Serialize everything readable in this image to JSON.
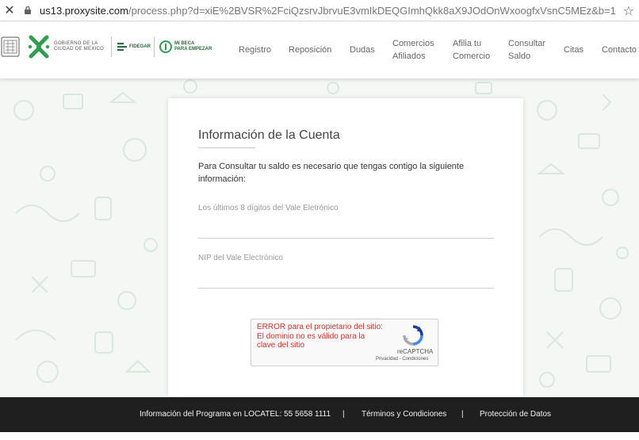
{
  "browser": {
    "url_host": "us13.proxysite.com",
    "url_path": "/process.php?d=xiE%2BVSR%2FciQzsrvJbrvuE3vmIkDEQGImhQkk8aX9JOdOnWxoogfxVsnC5MEz&b=1",
    "close_glyph": "✕",
    "star_glyph": "☆"
  },
  "header": {
    "gov_line1": "GOBIERNO DE LA",
    "gov_line2": "CIUDAD DE MÉXICO",
    "fidegar": "FIDEGAR",
    "beca_line1": "MI BECA",
    "beca_line2": "PARA EMPEZAR",
    "nav": [
      {
        "line1": "Registro",
        "line2": ""
      },
      {
        "line1": "Reposición",
        "line2": ""
      },
      {
        "line1": "Dudas",
        "line2": ""
      },
      {
        "line1": "Comercios",
        "line2": "Afiliados"
      },
      {
        "line1": "Afilia tu",
        "line2": "Comercio"
      },
      {
        "line1": "Consultar",
        "line2": "Saldo"
      },
      {
        "line1": "Citas",
        "line2": ""
      },
      {
        "line1": "Contacto",
        "line2": ""
      }
    ]
  },
  "card": {
    "title": "Información de la Cuenta",
    "intro": "Para Consultar tu saldo es necesario que tengas contigo la siguiente información:",
    "field1_label": "Los últimos 8 dígitos del Vale Eletrónico",
    "field1_value": "",
    "field2_label": "NIP del Vale Electrónico",
    "field2_value": ""
  },
  "recaptcha": {
    "error_line1": "ERROR para el propietario del sitio:",
    "error_line2": "El dominio no es válido para la clave del sitio",
    "brand": "reCAPTCHA",
    "links": "Privacidad - Condiciones"
  },
  "footer": {
    "locatel": "Información del Programa en LOCATEL: 55 5658 1111",
    "separator": "|",
    "terms": "Términos y Condiciones",
    "privacy": "Protección de Datos"
  },
  "colors": {
    "accent_green": "#2a6a3c",
    "error_red": "#d93025",
    "footer_bg": "#1f1f1f"
  }
}
